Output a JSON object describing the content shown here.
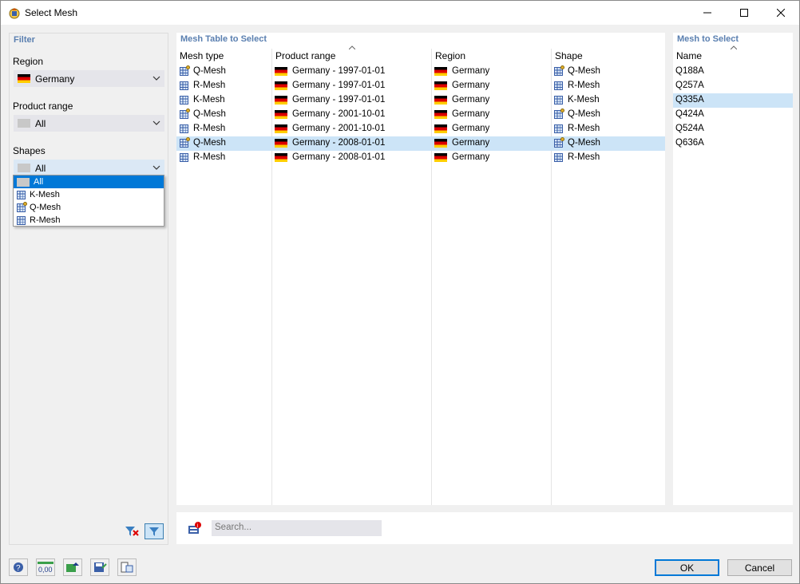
{
  "window": {
    "title": "Select Mesh"
  },
  "filter": {
    "header": "Filter",
    "region_label": "Region",
    "region_value": "Germany",
    "product_label": "Product range",
    "product_value": "All",
    "shapes_label": "Shapes",
    "shapes_value": "All",
    "shapes_options": [
      "All",
      "K-Mesh",
      "Q-Mesh",
      "R-Mesh"
    ]
  },
  "table": {
    "header": "Mesh Table to Select",
    "columns": [
      "Mesh type",
      "Product range",
      "Region",
      "Shape"
    ],
    "rows": [
      {
        "type": "Q-Mesh",
        "product": "Germany - 1997-01-01",
        "region": "Germany",
        "shape": "Q-Mesh"
      },
      {
        "type": "R-Mesh",
        "product": "Germany - 1997-01-01",
        "region": "Germany",
        "shape": "R-Mesh"
      },
      {
        "type": "K-Mesh",
        "product": "Germany - 1997-01-01",
        "region": "Germany",
        "shape": "K-Mesh"
      },
      {
        "type": "Q-Mesh",
        "product": "Germany - 2001-10-01",
        "region": "Germany",
        "shape": "Q-Mesh"
      },
      {
        "type": "R-Mesh",
        "product": "Germany - 2001-10-01",
        "region": "Germany",
        "shape": "R-Mesh"
      },
      {
        "type": "Q-Mesh",
        "product": "Germany - 2008-01-01",
        "region": "Germany",
        "shape": "Q-Mesh"
      },
      {
        "type": "R-Mesh",
        "product": "Germany - 2008-01-01",
        "region": "Germany",
        "shape": "R-Mesh"
      }
    ],
    "selected_row": 5
  },
  "names": {
    "header": "Mesh to Select",
    "column": "Name",
    "items": [
      "Q188A",
      "Q257A",
      "Q335A",
      "Q424A",
      "Q524A",
      "Q636A"
    ],
    "selected": 2
  },
  "search": {
    "placeholder": "Search..."
  },
  "tools": {
    "units_label": "0,00"
  },
  "buttons": {
    "ok": "OK",
    "cancel": "Cancel"
  },
  "colors": {
    "selection": "#cce4f7",
    "accent": "#0078d7",
    "header_text": "#5a7fb0"
  }
}
